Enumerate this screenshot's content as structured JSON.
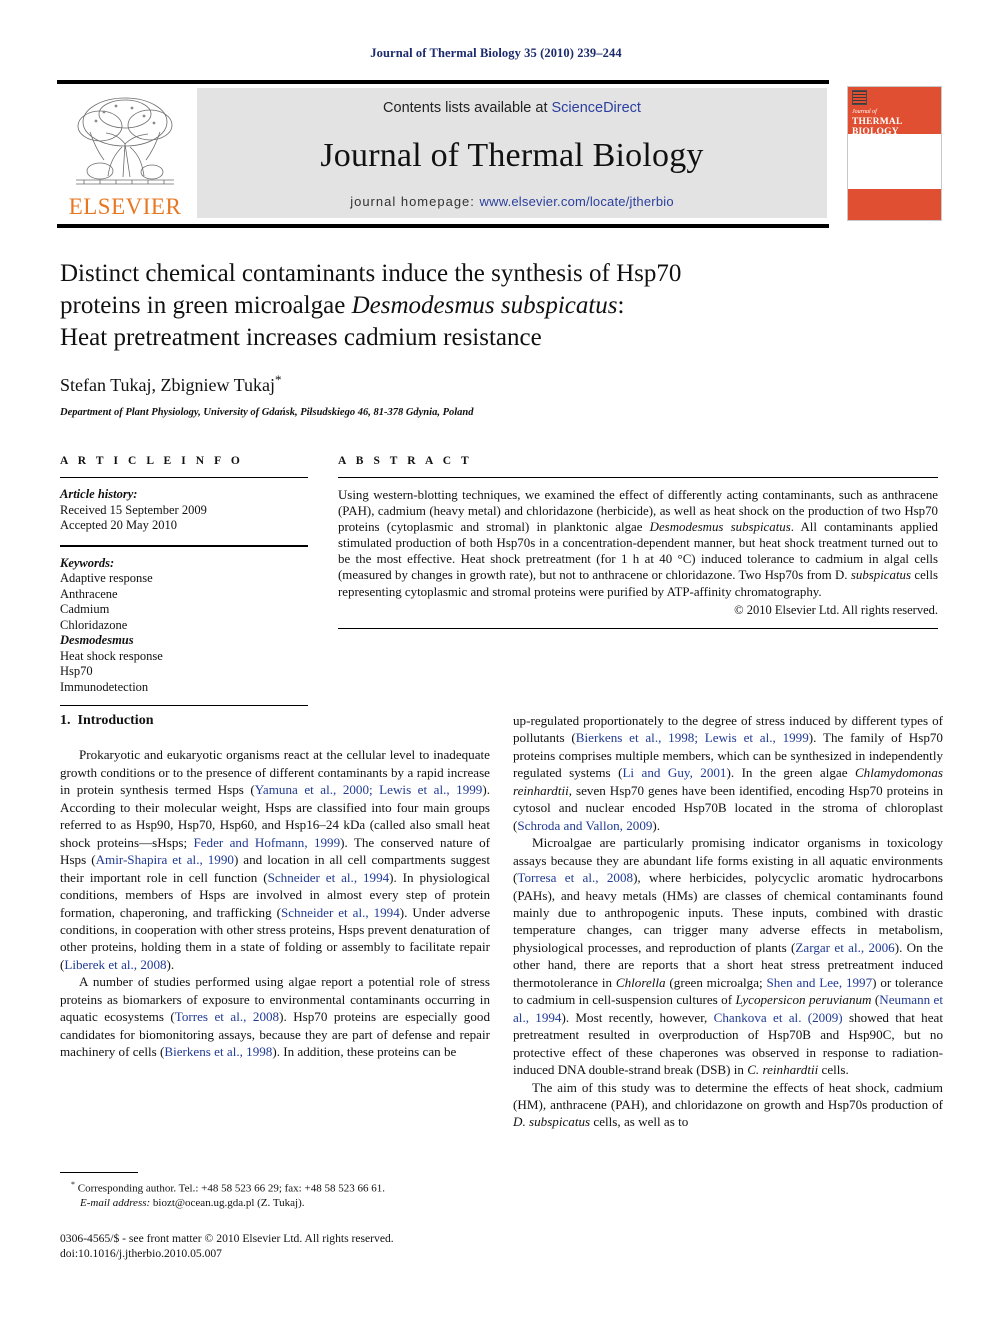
{
  "running_head": "Journal of Thermal Biology 35 (2010) 239–244",
  "masthead": {
    "publisher_name": "ELSEVIER",
    "publisher_logo_icon": "elsevier-tree-icon",
    "contents_prefix": "Contents lists available at ",
    "contents_link": "ScienceDirect",
    "journal_title": "Journal of Thermal Biology",
    "homepage_prefix": "journal homepage: ",
    "homepage_url": "www.elsevier.com/locate/jtherbio",
    "cover": {
      "journal_of": "Journal of",
      "journal_name": "THERMAL BIOLOGY",
      "accent_color": "#e04f31",
      "logo_icon": "journal-cover-mini-logo-icon"
    },
    "link_color": "#2b3f9e"
  },
  "article": {
    "title_line1": "Distinct chemical contaminants induce the synthesis of Hsp70",
    "title_line2_pre": "proteins in green microalgae ",
    "title_line2_italic": "Desmodesmus subspicatus",
    "title_line2_post": ":",
    "title_line3": "Heat pretreatment increases cadmium resistance",
    "authors": "Stefan Tukaj, Zbigniew Tukaj",
    "author_star": "*",
    "affiliation": "Department of Plant Physiology, University of Gdańsk, Piłsudskiego 46, 81-378 Gdynia, Poland"
  },
  "info": {
    "heading": "A R T I C L E   I N F O",
    "history_label": "Article history:",
    "history_lines": [
      "Received 15 September 2009",
      "Accepted 20 May 2010"
    ],
    "keywords_label": "Keywords:",
    "keywords": [
      "Adaptive response",
      "Anthracene",
      "Cadmium",
      "Chloridazone",
      "Desmodesmus",
      "Heat shock response",
      "Hsp70",
      "Immunodetection"
    ],
    "keyword_italic_index": 4
  },
  "abstract": {
    "heading": "A B S T R A C T",
    "p1_a": "Using western-blotting techniques, we examined the effect of differently acting contaminants, such as anthracene (PAH), cadmium (heavy metal) and chloridazone (herbicide), as well as heat shock on the production of two Hsp70 proteins (cytoplasmic and stromal) in planktonic algae ",
    "p1_sp1": "Desmodesmus subspicatus",
    "p1_b": ". All contaminants applied stimulated production of both Hsp70s in a concentration-dependent manner, but heat shock treatment turned out to be the most effective. Heat shock pretreatment (for 1 h at 40 °C) induced tolerance to cadmium in algal cells (measured by changes in growth rate), but not to anthracene or chloridazone. Two Hsp70s from D. ",
    "p1_sp2": "subspicatus",
    "p1_c": " cells representing cytoplasmic and stromal proteins were purified by ATP-affinity chromatography.",
    "copyright": "© 2010 Elsevier Ltd. All rights reserved."
  },
  "body": {
    "section_number": "1.",
    "section_title": "Introduction",
    "left": {
      "p1_a": "Prokaryotic and eukaryotic organisms react at the cellular level to inadequate growth conditions or to the presence of different contaminants by a rapid increase in protein synthesis termed Hsps (",
      "p1_r1": "Yamuna et al., 2000; Lewis et al., 1999",
      "p1_b": "). According to their molecular weight, Hsps are classified into four main groups referred to as Hsp90, Hsp70, Hsp60, and Hsp16–24 kDa (called also small heat shock proteins—sHsps; ",
      "p1_r2": "Feder and Hofmann, 1999",
      "p1_c": "). The conserved nature of Hsps (",
      "p1_r3": "Amir-Shapira et al., 1990",
      "p1_d": ") and location in all cell compartments suggest their important role in cell function (",
      "p1_r4": "Schneider et al., 1994",
      "p1_e": "). In physiological conditions, members of Hsps are involved in almost every step of protein formation, chaperoning, and trafficking (",
      "p1_r5": "Schneider et al., 1994",
      "p1_f": "). Under adverse conditions, in cooperation with other stress proteins, Hsps prevent denaturation of other proteins, holding them in a state of folding or assembly to facilitate repair (",
      "p1_r6": "Liberek et al., 2008",
      "p1_g": ").",
      "p2_a": "A number of studies performed using algae report a potential role of stress proteins as biomarkers of exposure to environmental contaminants occurring in aquatic ecosystems (",
      "p2_r1": "Torres et al., 2008",
      "p2_b": "). Hsp70 proteins are especially good candidates for biomonitoring assays, because they are part of defense and repair machinery of cells (",
      "p2_r2": "Bierkens et al., 1998",
      "p2_c": "). In addition, these proteins can be"
    },
    "right": {
      "p1_a": "up-regulated proportionately to the degree of stress induced by different types of pollutants (",
      "p1_r1": "Bierkens et al., 1998; Lewis et al., 1999",
      "p1_b": "). The family of Hsp70 proteins comprises multiple members, which can be synthesized in independently regulated systems (",
      "p1_r2": "Li and Guy, 2001",
      "p1_c": "). In the green algae ",
      "p1_sp1": "Chlamydomonas reinhardtii",
      "p1_d": ", seven Hsp70 genes have been identified, encoding Hsp70 proteins in cytosol and nuclear encoded Hsp70B located in the stroma of chloroplast (",
      "p1_r3": "Schroda and Vallon, 2009",
      "p1_e": ").",
      "p2_a": "Microalgae are particularly promising indicator organisms in toxicology assays because they are abundant life forms existing in all aquatic environments (",
      "p2_r1": "Torresa et al., 2008",
      "p2_b": "), where herbicides, polycyclic aromatic hydrocarbons (PAHs), and heavy metals (HMs) are classes of chemical contaminants found mainly due to anthropogenic inputs. These inputs, combined with drastic temperature changes, can trigger many adverse effects in metabolism, physiological processes, and reproduction of plants (",
      "p2_r2": "Zargar et al., 2006",
      "p2_c": "). On the other hand, there are reports that a short heat stress pretreatment induced thermotolerance in ",
      "p2_sp1": "Chlorella",
      "p2_d": " (green microalga; ",
      "p2_r3": "Shen and Lee, 1997",
      "p2_e": ") or tolerance to cadmium in cell-suspension cultures of ",
      "p2_sp2": "Lycopersicon peruvianum",
      "p2_f": " (",
      "p2_r4": "Neumann et al., 1994",
      "p2_g": "). Most recently, however, ",
      "p2_r5": "Chankova et al. (2009)",
      "p2_h": " showed that heat pretreatment resulted in overproduction of Hsp70B and Hsp90C, but no protective effect of these chaperones was observed in response to radiation-induced DNA double-strand break (DSB) in ",
      "p2_sp3": "C. reinhardtii",
      "p2_i": " cells.",
      "p3_a": "The aim of this study was to determine the effects of heat shock, cadmium (HM), anthracene (PAH), and chloridazone on growth and Hsp70s production of ",
      "p3_sp1": "D. subspicatus",
      "p3_b": " cells, as well as to"
    }
  },
  "footnote": {
    "star": "*",
    "line1": " Corresponding author. Tel.: +48 58 523 66 29; fax: +48 58 523 66 61.",
    "email_label": "E-mail address:",
    "email_value": " biozt@ocean.ug.gda.pl (Z. Tukaj)."
  },
  "footer": {
    "line1": "0306-4565/$ - see front matter © 2010 Elsevier Ltd. All rights reserved.",
    "line2": "doi:10.1016/j.jtherbio.2010.05.007"
  }
}
